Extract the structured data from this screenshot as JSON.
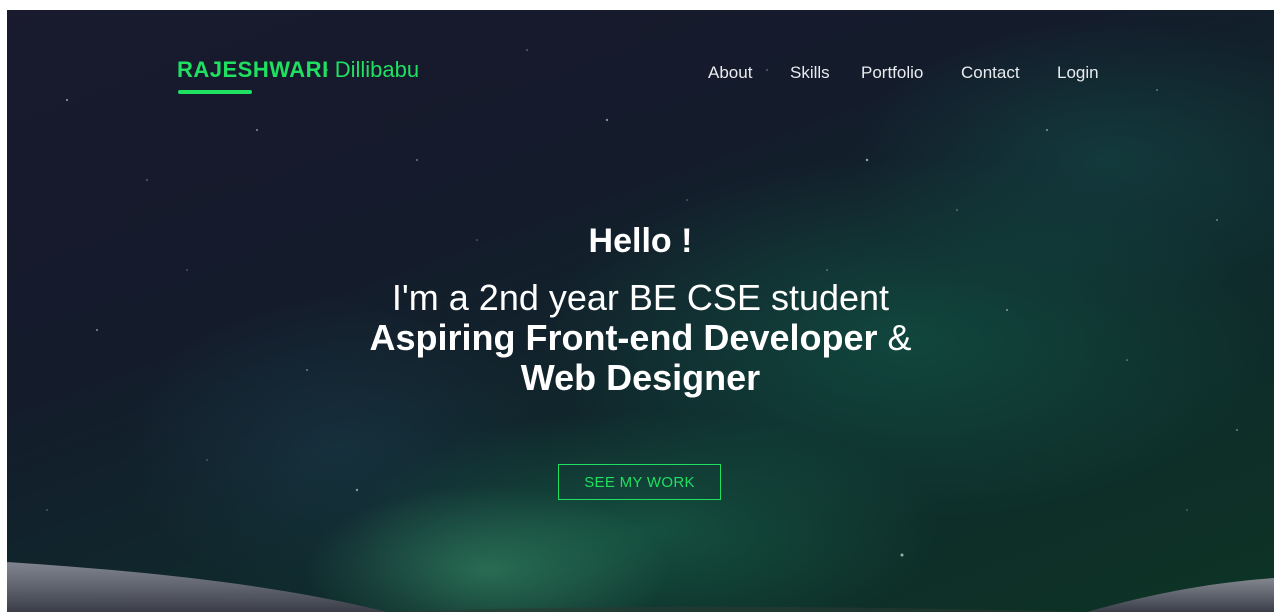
{
  "header": {
    "logo_first": "RAJESHWARI",
    "logo_last": "Dillibabu",
    "nav": [
      "About",
      "Skills",
      "Portfolio",
      "Contact",
      "Login"
    ]
  },
  "hero": {
    "greeting": "Hello !",
    "line1": "I'm a 2nd year BE CSE student",
    "line2_bold": "Aspiring Front-end Developer",
    "line2_rest": "&",
    "line3_bold": "Web Designer",
    "cta_label": "SEE MY WORK"
  },
  "colors": {
    "accent": "#1fe060",
    "text": "#ffffff",
    "nav_text": "#e8ecef"
  }
}
